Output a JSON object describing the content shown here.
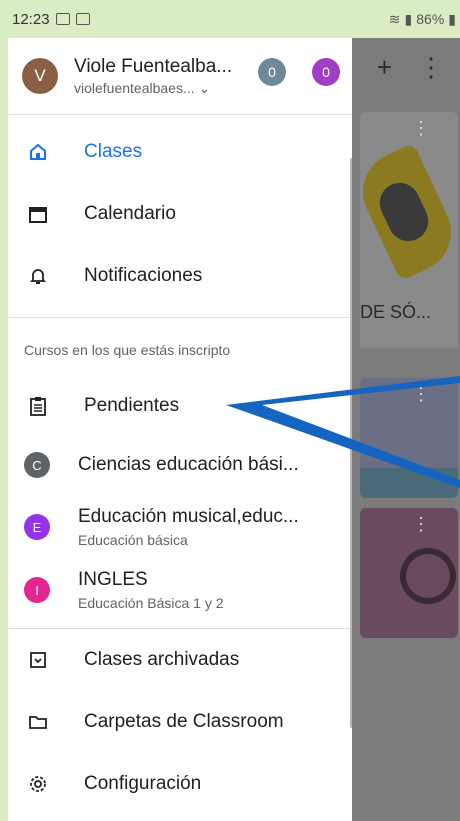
{
  "statusbar": {
    "time": "12:23",
    "battery": "86%"
  },
  "background_app": {
    "add_icon": "plus-icon",
    "menu_icon": "more-vert-icon",
    "card_text": "DE SÓ..."
  },
  "account": {
    "avatar_letter": "V",
    "name": "Viole Fuentealba...",
    "email": "violefuentealbaes... ⌄",
    "badge1": "0",
    "badge2": "0"
  },
  "nav": {
    "items": [
      {
        "label": "Clases",
        "icon": "home-icon",
        "active": true
      },
      {
        "label": "Calendario",
        "icon": "calendar-icon"
      },
      {
        "label": "Notificaciones",
        "icon": "bell-icon"
      }
    ]
  },
  "enrolled": {
    "section_title": "Cursos en los que estás inscripto",
    "todo_label": "Pendientes",
    "courses": [
      {
        "letter": "C",
        "name": "Ciencias educación bási...",
        "sub": "",
        "color": "#5f6368"
      },
      {
        "letter": "E",
        "name": "Educación musical,educ...",
        "sub": "Educación básica",
        "color": "#9334e6"
      },
      {
        "letter": "I",
        "name": "INGLES",
        "sub": "Educación Básica 1 y 2",
        "color": "#e52592"
      }
    ]
  },
  "footer_nav": {
    "items": [
      {
        "label": "Clases archivadas",
        "icon": "archive-icon"
      },
      {
        "label": "Carpetas de Classroom",
        "icon": "folder-icon"
      },
      {
        "label": "Configuración",
        "icon": "settings-icon"
      }
    ]
  },
  "colors": {
    "accent": "#1a73e8",
    "frame": "#d9ecc4",
    "annotation_arrow": "#1565c0"
  }
}
